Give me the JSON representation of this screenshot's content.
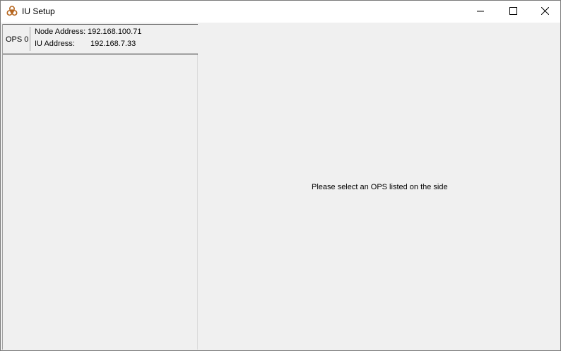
{
  "window": {
    "title": "IU Setup",
    "app_icon": "biohazard-icon",
    "controls": [
      "minimize-icon",
      "maximize-icon",
      "close-icon"
    ]
  },
  "sidebar": {
    "items": [
      {
        "name": "OPS 0",
        "node_address_label": "Node Address:",
        "node_address": "192.168.100.71",
        "iu_address_label": "IU Address:",
        "iu_address": "192.168.7.33"
      }
    ]
  },
  "main": {
    "placeholder": "Please select an OPS listed on the side"
  },
  "colors": {
    "background": "#f0f0f0",
    "titlebar": "#ffffff",
    "icon": "#b5651d"
  }
}
